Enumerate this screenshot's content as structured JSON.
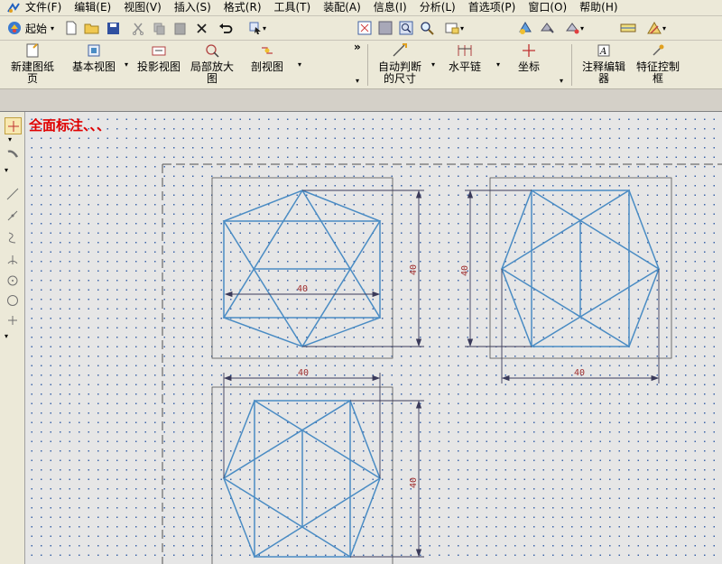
{
  "menubar": {
    "items": [
      "文件(F)",
      "编辑(E)",
      "视图(V)",
      "插入(S)",
      "格式(R)",
      "工具(T)",
      "装配(A)",
      "信息(I)",
      "分析(L)",
      "首选项(P)",
      "窗口(O)",
      "帮助(H)"
    ]
  },
  "toolbar": {
    "start_label": "起始"
  },
  "ribbon": {
    "new_sheet": [
      "新建图纸",
      "页"
    ],
    "base_view": "基本视图",
    "projected_view": "投影视图",
    "detail_view": [
      "局部放大",
      "图"
    ],
    "section_view": "剖视图",
    "auto_dim": [
      "自动判断",
      "的尺寸"
    ],
    "horizontal_chain": "水平链",
    "coordinate": "坐标",
    "note_editor": [
      "注释编辑",
      "器"
    ],
    "feature_control": [
      "特征控制",
      "框"
    ],
    "more": "»"
  },
  "canvas": {
    "note": "全面标注、、、",
    "dimensions": [
      "40",
      "40",
      "40",
      "40",
      "40"
    ]
  },
  "colors": {
    "geometry": "#4a8cc4",
    "dimension": "#3a3a5a",
    "dim_text": "#a03030",
    "note": "#e00000"
  },
  "icons": [
    "app-icon",
    "start-icon",
    "new-file-icon",
    "open-folder-icon",
    "save-icon",
    "cut-icon",
    "copy-icon",
    "paste-icon",
    "delete-icon",
    "undo-icon",
    "select-icon",
    "fit-icon",
    "zoom-icon",
    "pan-icon",
    "magnify-icon",
    "view-orient-icon"
  ]
}
